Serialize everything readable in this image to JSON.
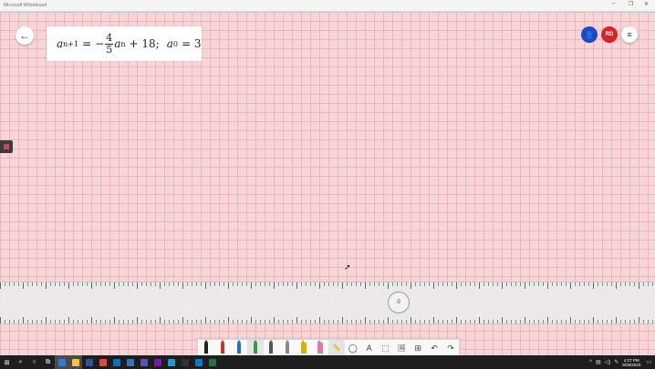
{
  "window": {
    "title": "Microsoft Whiteboard",
    "controls": [
      "–",
      "❐",
      "✕"
    ]
  },
  "formula": {
    "lhs_var": "a",
    "lhs_sub": "n+1",
    "eq": "=",
    "neg": "−",
    "frac_num": "4",
    "frac_den": "5",
    "rhs_var": "a",
    "rhs_sub": "n",
    "plus_term": "+ 18;",
    "init_var": "a",
    "init_sub": "0",
    "init_val": "= 3"
  },
  "header": {
    "back_icon": "←",
    "user_icon": "👤",
    "avatar_initials": "RD",
    "menu_icon": "≡"
  },
  "ruler": {
    "angle": "0"
  },
  "toolbar": {
    "tools": [
      {
        "name": "pen-black",
        "color": "#222222"
      },
      {
        "name": "pen-red",
        "color": "#c0392b"
      },
      {
        "name": "pen-blue",
        "color": "#2a6fb0"
      },
      {
        "name": "pen-green",
        "color": "#2e9b48"
      },
      {
        "name": "pencil",
        "color": "#555555"
      },
      {
        "name": "pencil-light",
        "color": "#888888"
      },
      {
        "name": "highlighter",
        "color": "#d8b400"
      },
      {
        "name": "eraser",
        "color": "#e27aa2"
      }
    ],
    "ruler_icon": "📏",
    "lasso_icon": "◯",
    "text_icon": "A",
    "shape_icon": "⬚",
    "image_icon": "🖼",
    "insert_icon": "⊞",
    "undo_icon": "↶",
    "redo_icon": "↷"
  },
  "taskbar": {
    "start_icon": "⊞",
    "search_icon": "⌕",
    "cortana_icon": "○",
    "taskview_icon": "⧉",
    "apps": [
      {
        "name": "store",
        "color": "#2c7ad6"
      },
      {
        "name": "explorer",
        "color": "#f3c13a"
      },
      {
        "name": "word",
        "color": "#2b579a"
      },
      {
        "name": "chrome",
        "color": "#e8453c"
      },
      {
        "name": "outlook",
        "color": "#0072c6"
      },
      {
        "name": "edge",
        "color": "#3277bc"
      },
      {
        "name": "teams",
        "color": "#5558af"
      },
      {
        "name": "onenote",
        "color": "#7719aa"
      },
      {
        "name": "whiteboard",
        "color": "#1c9bd7"
      },
      {
        "name": "app-dark",
        "color": "#333333"
      },
      {
        "name": "photos",
        "color": "#0078d7"
      },
      {
        "name": "excel",
        "color": "#217346"
      }
    ],
    "time": "4:27 PM",
    "date": "9/28/2020"
  }
}
